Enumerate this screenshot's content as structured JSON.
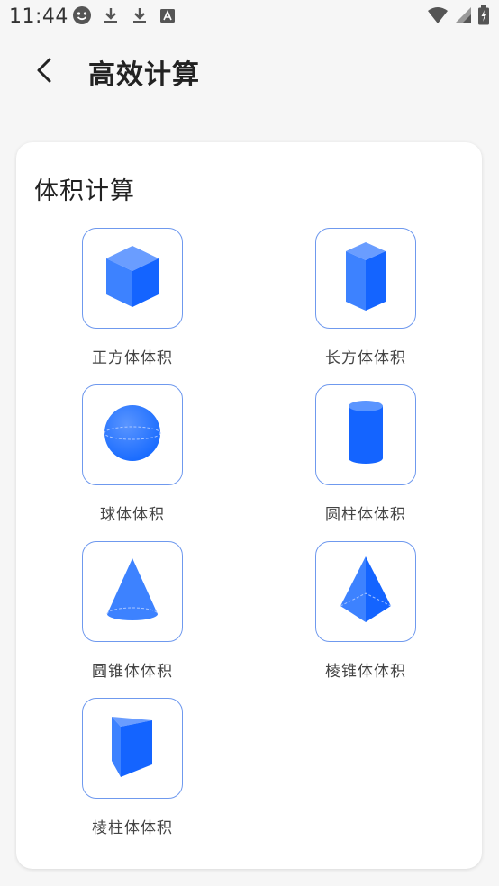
{
  "status_bar": {
    "time": "11:44",
    "left_icons": [
      "smiley-icon",
      "download-icon",
      "download-icon",
      "font-a-icon"
    ],
    "right_icons": [
      "wifi-icon",
      "signal-icon",
      "battery-icon"
    ]
  },
  "app_bar": {
    "back_icon": "chevron-left-icon",
    "title": "高效计算"
  },
  "card": {
    "section_title": "体积计算",
    "items": [
      {
        "label": "正方体体积",
        "icon": "cube-icon"
      },
      {
        "label": "长方体体积",
        "icon": "cuboid-icon"
      },
      {
        "label": "球体体积",
        "icon": "sphere-icon"
      },
      {
        "label": "圆柱体体积",
        "icon": "cylinder-icon"
      },
      {
        "label": "圆锥体体积",
        "icon": "cone-icon"
      },
      {
        "label": "棱锥体体积",
        "icon": "pyramid-icon"
      },
      {
        "label": "棱柱体体积",
        "icon": "prism-icon"
      }
    ]
  },
  "colors": {
    "accent": "#1a6cff",
    "accent_light": "#5a95ff",
    "tile_border": "#6f99ee",
    "background": "#f6f6f6"
  }
}
